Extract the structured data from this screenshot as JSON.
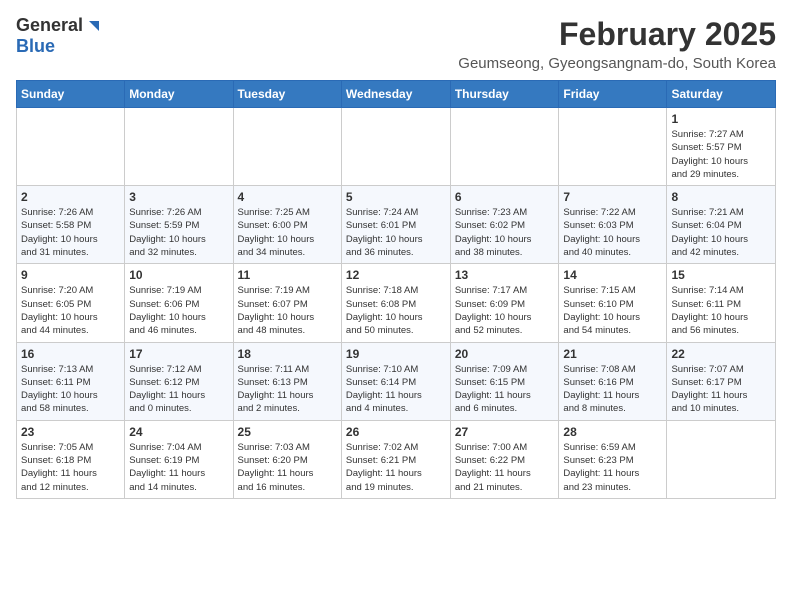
{
  "logo": {
    "general": "General",
    "blue": "Blue"
  },
  "title": "February 2025",
  "subtitle": "Geumseong, Gyeongsangnam-do, South Korea",
  "days": [
    "Sunday",
    "Monday",
    "Tuesday",
    "Wednesday",
    "Thursday",
    "Friday",
    "Saturday"
  ],
  "weeks": [
    [
      {
        "day": "",
        "info": ""
      },
      {
        "day": "",
        "info": ""
      },
      {
        "day": "",
        "info": ""
      },
      {
        "day": "",
        "info": ""
      },
      {
        "day": "",
        "info": ""
      },
      {
        "day": "",
        "info": ""
      },
      {
        "day": "1",
        "info": "Sunrise: 7:27 AM\nSunset: 5:57 PM\nDaylight: 10 hours\nand 29 minutes."
      }
    ],
    [
      {
        "day": "2",
        "info": "Sunrise: 7:26 AM\nSunset: 5:58 PM\nDaylight: 10 hours\nand 31 minutes."
      },
      {
        "day": "3",
        "info": "Sunrise: 7:26 AM\nSunset: 5:59 PM\nDaylight: 10 hours\nand 32 minutes."
      },
      {
        "day": "4",
        "info": "Sunrise: 7:25 AM\nSunset: 6:00 PM\nDaylight: 10 hours\nand 34 minutes."
      },
      {
        "day": "5",
        "info": "Sunrise: 7:24 AM\nSunset: 6:01 PM\nDaylight: 10 hours\nand 36 minutes."
      },
      {
        "day": "6",
        "info": "Sunrise: 7:23 AM\nSunset: 6:02 PM\nDaylight: 10 hours\nand 38 minutes."
      },
      {
        "day": "7",
        "info": "Sunrise: 7:22 AM\nSunset: 6:03 PM\nDaylight: 10 hours\nand 40 minutes."
      },
      {
        "day": "8",
        "info": "Sunrise: 7:21 AM\nSunset: 6:04 PM\nDaylight: 10 hours\nand 42 minutes."
      }
    ],
    [
      {
        "day": "9",
        "info": "Sunrise: 7:20 AM\nSunset: 6:05 PM\nDaylight: 10 hours\nand 44 minutes."
      },
      {
        "day": "10",
        "info": "Sunrise: 7:19 AM\nSunset: 6:06 PM\nDaylight: 10 hours\nand 46 minutes."
      },
      {
        "day": "11",
        "info": "Sunrise: 7:19 AM\nSunset: 6:07 PM\nDaylight: 10 hours\nand 48 minutes."
      },
      {
        "day": "12",
        "info": "Sunrise: 7:18 AM\nSunset: 6:08 PM\nDaylight: 10 hours\nand 50 minutes."
      },
      {
        "day": "13",
        "info": "Sunrise: 7:17 AM\nSunset: 6:09 PM\nDaylight: 10 hours\nand 52 minutes."
      },
      {
        "day": "14",
        "info": "Sunrise: 7:15 AM\nSunset: 6:10 PM\nDaylight: 10 hours\nand 54 minutes."
      },
      {
        "day": "15",
        "info": "Sunrise: 7:14 AM\nSunset: 6:11 PM\nDaylight: 10 hours\nand 56 minutes."
      }
    ],
    [
      {
        "day": "16",
        "info": "Sunrise: 7:13 AM\nSunset: 6:11 PM\nDaylight: 10 hours\nand 58 minutes."
      },
      {
        "day": "17",
        "info": "Sunrise: 7:12 AM\nSunset: 6:12 PM\nDaylight: 11 hours\nand 0 minutes."
      },
      {
        "day": "18",
        "info": "Sunrise: 7:11 AM\nSunset: 6:13 PM\nDaylight: 11 hours\nand 2 minutes."
      },
      {
        "day": "19",
        "info": "Sunrise: 7:10 AM\nSunset: 6:14 PM\nDaylight: 11 hours\nand 4 minutes."
      },
      {
        "day": "20",
        "info": "Sunrise: 7:09 AM\nSunset: 6:15 PM\nDaylight: 11 hours\nand 6 minutes."
      },
      {
        "day": "21",
        "info": "Sunrise: 7:08 AM\nSunset: 6:16 PM\nDaylight: 11 hours\nand 8 minutes."
      },
      {
        "day": "22",
        "info": "Sunrise: 7:07 AM\nSunset: 6:17 PM\nDaylight: 11 hours\nand 10 minutes."
      }
    ],
    [
      {
        "day": "23",
        "info": "Sunrise: 7:05 AM\nSunset: 6:18 PM\nDaylight: 11 hours\nand 12 minutes."
      },
      {
        "day": "24",
        "info": "Sunrise: 7:04 AM\nSunset: 6:19 PM\nDaylight: 11 hours\nand 14 minutes."
      },
      {
        "day": "25",
        "info": "Sunrise: 7:03 AM\nSunset: 6:20 PM\nDaylight: 11 hours\nand 16 minutes."
      },
      {
        "day": "26",
        "info": "Sunrise: 7:02 AM\nSunset: 6:21 PM\nDaylight: 11 hours\nand 19 minutes."
      },
      {
        "day": "27",
        "info": "Sunrise: 7:00 AM\nSunset: 6:22 PM\nDaylight: 11 hours\nand 21 minutes."
      },
      {
        "day": "28",
        "info": "Sunrise: 6:59 AM\nSunset: 6:23 PM\nDaylight: 11 hours\nand 23 minutes."
      },
      {
        "day": "",
        "info": ""
      }
    ]
  ]
}
